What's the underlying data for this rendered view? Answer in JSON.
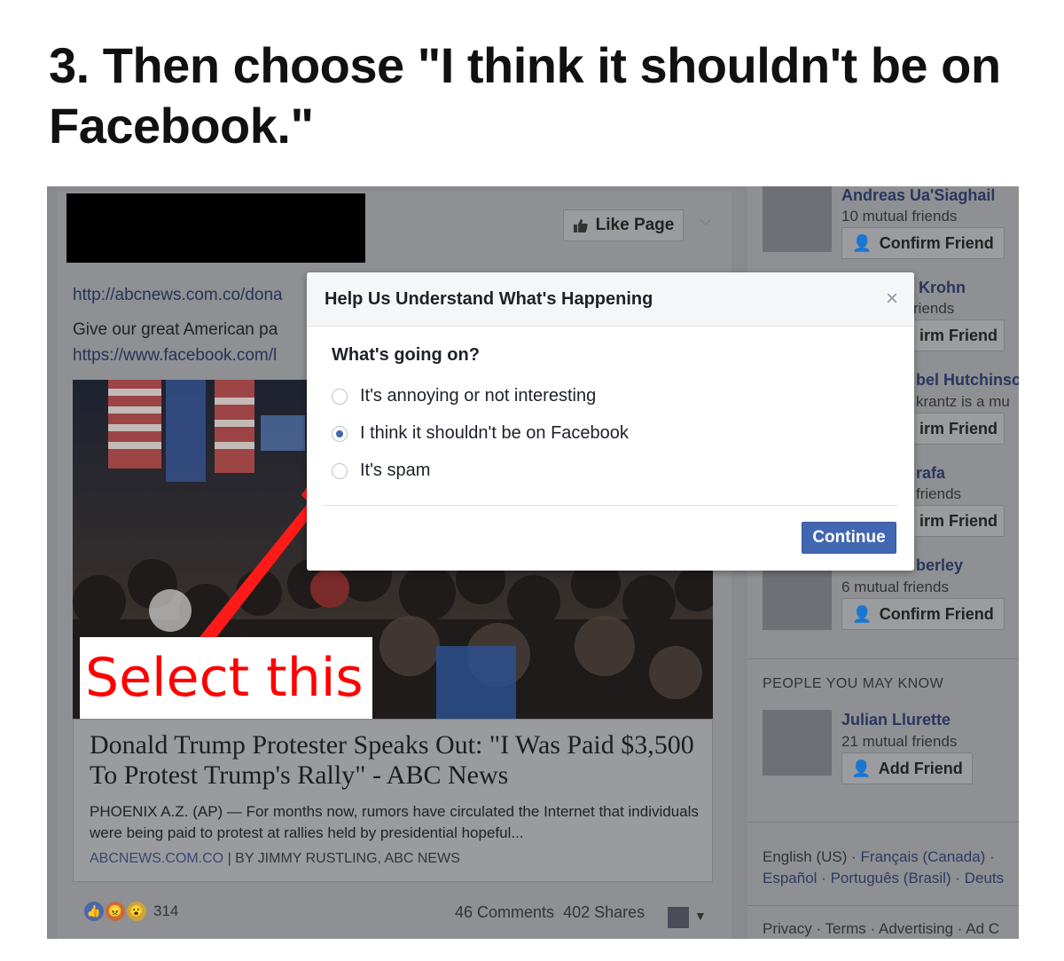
{
  "heading": "3. Then choose \"I think it shouldn't be on Facebook.\"",
  "post": {
    "like_page_label": "Like Page",
    "link1": "http://abcnews.com.co/dona",
    "text1": "Give our great American pa",
    "link2": "https://www.facebook.com/l",
    "annotation": "Select this",
    "article_title": "Donald Trump Protester Speaks Out: \"I Was Paid $3,500 To Protest Trump's Rally\" - ABC News",
    "article_desc": "PHOENIX A.Z. (AP) — For months now, rumors have circulated the Internet that individuals were being paid to protest at rallies held by presidential hopeful...",
    "article_source": "ABCNEWS.COM.CO",
    "article_byline": "| BY JIMMY RUSTLING, ABC NEWS",
    "reaction_count": "314",
    "comments": "46 Comments",
    "shares": "402 Shares"
  },
  "right_column": {
    "friends": [
      {
        "name": "Andreas Ua'Siaghail",
        "sub": "10 mutual friends",
        "button": "Confirm Friend"
      },
      {
        "name": "Krohn",
        "sub": "riends",
        "button": "irm Friend"
      },
      {
        "name": "bel Hutchinsc",
        "sub": "krantz is a mu",
        "button": "irm Friend"
      },
      {
        "name": "rafa",
        "sub": "friends",
        "button": "irm Friend"
      },
      {
        "name": "berley",
        "sub": "6 mutual friends",
        "button": "Confirm Friend"
      }
    ],
    "pymk_heading": "PEOPLE YOU MAY KNOW",
    "pymk": {
      "name": "Julian Llurette",
      "sub": "21 mutual friends",
      "button": "Add Friend"
    },
    "footer_lang_1": "English (US) ·",
    "footer_lang_2": "Français (Canada) ·",
    "footer_lang_3": "Español ·",
    "footer_lang_4": "Português (Brasil) ·",
    "footer_lang_5": "Deuts",
    "footer_links": "Privacy · Terms · Advertising · Ad C"
  },
  "dialog": {
    "title": "Help Us Understand What's Happening",
    "close": "×",
    "question": "What's going on?",
    "options": [
      {
        "label": "It's annoying or not interesting",
        "selected": false
      },
      {
        "label": "I think it shouldn't be on Facebook",
        "selected": true
      },
      {
        "label": "It's spam",
        "selected": false
      }
    ],
    "continue_label": "Continue"
  },
  "colors": {
    "facebook_blue": "#4267b2",
    "annotation_red": "#ff0000",
    "overlay_gray": "#898a8e"
  }
}
